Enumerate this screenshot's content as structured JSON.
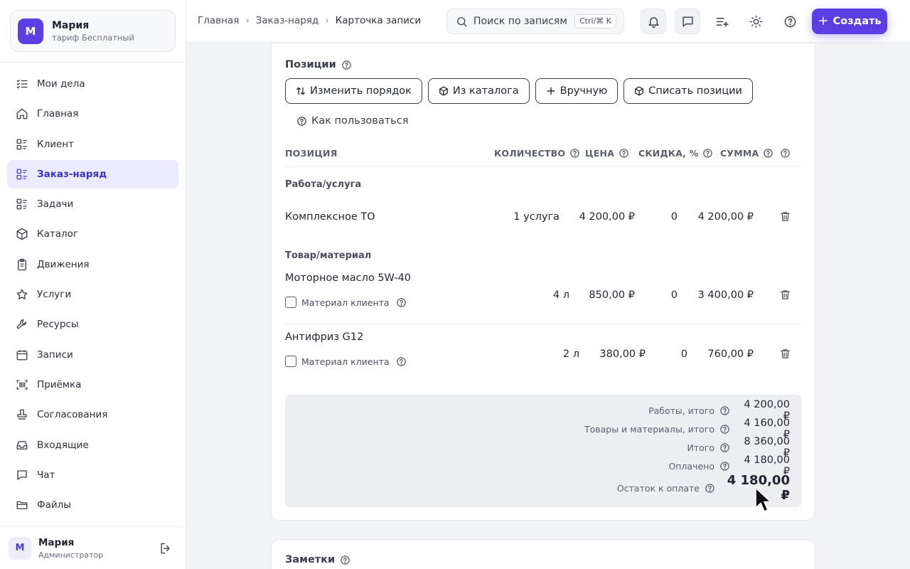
{
  "account": {
    "initial": "М",
    "name": "Мария",
    "plan": "тариф Бесплатный"
  },
  "nav": [
    {
      "label": "Мои дела",
      "icon": "list-check-icon"
    },
    {
      "label": "Главная",
      "icon": "home-icon"
    },
    {
      "label": "Клиент",
      "icon": "list-grid-icon"
    },
    {
      "label": "Заказ-наряд",
      "icon": "list-grid-icon",
      "active": true
    },
    {
      "label": "Задачи",
      "icon": "list-grid-icon"
    },
    {
      "label": "Каталог",
      "icon": "box-icon"
    },
    {
      "label": "Движения",
      "icon": "clipboard-icon"
    },
    {
      "label": "Услуги",
      "icon": "star-icon"
    },
    {
      "label": "Ресурсы",
      "icon": "wrench-icon"
    },
    {
      "label": "Записи",
      "icon": "calendar-icon"
    },
    {
      "label": "Приёмка",
      "icon": "scan-icon"
    },
    {
      "label": "Согласования",
      "icon": "stamp-icon"
    },
    {
      "label": "Входящие",
      "icon": "inbox-icon"
    },
    {
      "label": "Чат",
      "icon": "chat-icon"
    },
    {
      "label": "Файлы",
      "icon": "folder-icon"
    }
  ],
  "user": {
    "initial": "М",
    "name": "Мария",
    "role": "Администратор"
  },
  "breadcrumbs": [
    "Главная",
    "Заказ-наряд",
    "Карточка записи"
  ],
  "search": {
    "placeholder": "Поиск по записям",
    "shortcut": "Ctrl/⌘ K"
  },
  "create_label": "Создать",
  "positions": {
    "title": "Позиции",
    "buttons": [
      "Изменить порядок",
      "Из каталога",
      "Вручную",
      "Списать позиции"
    ],
    "howto": "Как пользоваться",
    "columns": {
      "position": "ПОЗИЦИЯ",
      "quantity": "КОЛИЧЕСТВО",
      "price": "ЦЕНА",
      "discount": "СКИДКА, %",
      "sum": "СУММА"
    },
    "groups": {
      "work": "Работа/услуга",
      "goods": "Товар/материал"
    },
    "rows": [
      {
        "name": "Комплексное ТО",
        "qty": "1 услуга",
        "price": "4 200,00 ₽",
        "discount": "0",
        "sum": "4 200,00 ₽"
      },
      {
        "name": "Моторное масло 5W-40",
        "qty": "4 л",
        "price": "850,00 ₽",
        "discount": "0",
        "sum": "3 400,00 ₽",
        "client_material": "Материал клиента"
      },
      {
        "name": "Антифриз G12",
        "qty": "2 л",
        "price": "380,00 ₽",
        "discount": "0",
        "sum": "760,00 ₽",
        "client_material": "Материал клиента"
      }
    ]
  },
  "totals": {
    "works": {
      "label": "Работы, итого",
      "value": "4 200,00 ₽"
    },
    "goods": {
      "label": "Товары и материалы, итого",
      "value": "4 160,00 ₽"
    },
    "total": {
      "label": "Итого",
      "value": "8 360,00 ₽"
    },
    "paid": {
      "label": "Оплачено",
      "value": "4 180,00 ₽"
    },
    "remaining": {
      "label": "Остаток к оплате",
      "value": "4 180,00 ₽"
    }
  },
  "notes": {
    "title": "Заметки"
  },
  "colors": {
    "accent": "#5b3ee4",
    "active_bg": "#ebebfd",
    "totals_bg": "#eceef2"
  }
}
